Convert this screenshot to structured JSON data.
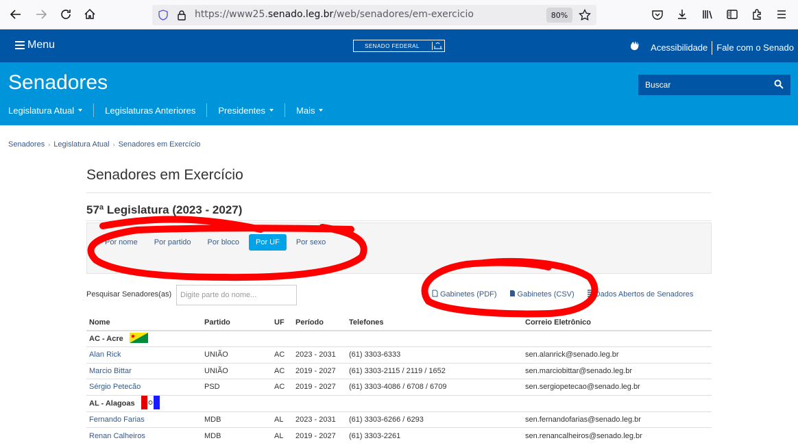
{
  "browser": {
    "url_prefix": "https://www25.",
    "url_host": "senado.leg.br",
    "url_path": "/web/senadores/em-exercicio",
    "zoom": "80%"
  },
  "topbar": {
    "menu_label": "Menu",
    "logo_text": "SENADO FEDERAL",
    "accessibility": "Acessibilidade",
    "contact": "Fale com o Senado"
  },
  "header": {
    "title": "Senadores",
    "search_placeholder": "Buscar",
    "nav": [
      {
        "label": "Legislatura Atual"
      },
      {
        "label": "Legislaturas Anteriores"
      },
      {
        "label": "Presidentes"
      },
      {
        "label": "Mais"
      }
    ]
  },
  "breadcrumb": [
    "Senadores",
    "Legislatura Atual",
    "Senadores em Exercício"
  ],
  "page": {
    "title": "Senadores em Exercício",
    "legislature": "57ª Legislatura (2023 - 2027)",
    "tabs": [
      "Por nome",
      "Por partido",
      "Por bloco",
      "Por UF",
      "Por sexo"
    ],
    "active_tab": "Por UF",
    "search_label": "Pesquisar Senadores(as)",
    "search_placeholder": "Digite parte do nome...",
    "links": [
      "Gabinetes (PDF)",
      "Gabinetes (CSV)",
      "Dados Abertos de Senadores"
    ]
  },
  "table": {
    "headers": [
      "Nome",
      "Partido",
      "UF",
      "Período",
      "Telefones",
      "Correio Eletrônico"
    ],
    "groups": [
      {
        "state": "AC - Acre",
        "rows": [
          [
            "Alan Rick",
            "UNIÃO",
            "AC",
            "2023 - 2031",
            "(61) 3303-6333",
            "sen.alanrick@senado.leg.br"
          ],
          [
            "Marcio Bittar",
            "UNIÃO",
            "AC",
            "2019 - 2027",
            "(61) 3303-2115 / 2119 / 1652",
            "sen.marciobittar@senado.leg.br"
          ],
          [
            "Sérgio Petecão",
            "PSD",
            "AC",
            "2019 - 2027",
            "(61) 3303-4086 / 6708 / 6709",
            "sen.sergiopetecao@senado.leg.br"
          ]
        ]
      },
      {
        "state": "AL - Alagoas",
        "rows": [
          [
            "Fernando Farias",
            "MDB",
            "AL",
            "2023 - 2031",
            "(61) 3303-6266 / 6293",
            "sen.fernandofarias@senado.leg.br"
          ],
          [
            "Renan Calheiros",
            "MDB",
            "AL",
            "2019 - 2027",
            "(61) 3303-2261",
            "sen.renancalheiros@senado.leg.br"
          ]
        ]
      }
    ]
  },
  "colors": {
    "top_bar": "#0055a5",
    "section_header": "#0095da",
    "active_tab": "#00a2e8",
    "link": "#36598a",
    "annotation": "#ff0000"
  }
}
